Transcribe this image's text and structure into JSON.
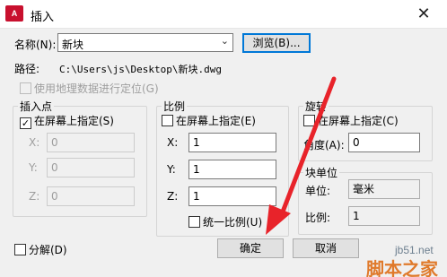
{
  "window": {
    "title": "插入",
    "app_icon_text": "A",
    "close_glyph": "✕"
  },
  "name_row": {
    "label": "名称(N):",
    "value": "新块",
    "browse_label": "浏览(B)..."
  },
  "path_row": {
    "label": "路径:",
    "value": "C:\\Users\\js\\Desktop\\新块.dwg"
  },
  "geo_checkbox": {
    "label": "使用地理数据进行定位(G)",
    "checked": false,
    "enabled": false
  },
  "insertion_point": {
    "title": "插入点",
    "specify_label": "在屏幕上指定(S)",
    "specify_checked": true,
    "x_label": "X:",
    "x_value": "0",
    "y_label": "Y:",
    "y_value": "0",
    "z_label": "Z:",
    "z_value": "0"
  },
  "scale": {
    "title": "比例",
    "specify_label": "在屏幕上指定(E)",
    "specify_checked": false,
    "x_label": "X:",
    "x_value": "1",
    "y_label": "Y:",
    "y_value": "1",
    "z_label": "Z:",
    "z_value": "1",
    "uniform_label": "统一比例(U)",
    "uniform_checked": false
  },
  "rotation": {
    "title": "旋转",
    "specify_label": "在屏幕上指定(C)",
    "specify_checked": false,
    "angle_label": "角度(A):",
    "angle_value": "0"
  },
  "block_unit": {
    "title": "块单位",
    "unit_label": "单位:",
    "unit_value": "毫米",
    "factor_label": "比例:",
    "factor_value": "1"
  },
  "explode": {
    "label": "分解(D)",
    "checked": false
  },
  "buttons": {
    "ok": "确定",
    "cancel": "取消"
  },
  "watermark": {
    "line1": "jb51.net",
    "line2": "脚本之家"
  },
  "colors": {
    "arrow": "#e8232a",
    "focus": "#0078d7"
  }
}
